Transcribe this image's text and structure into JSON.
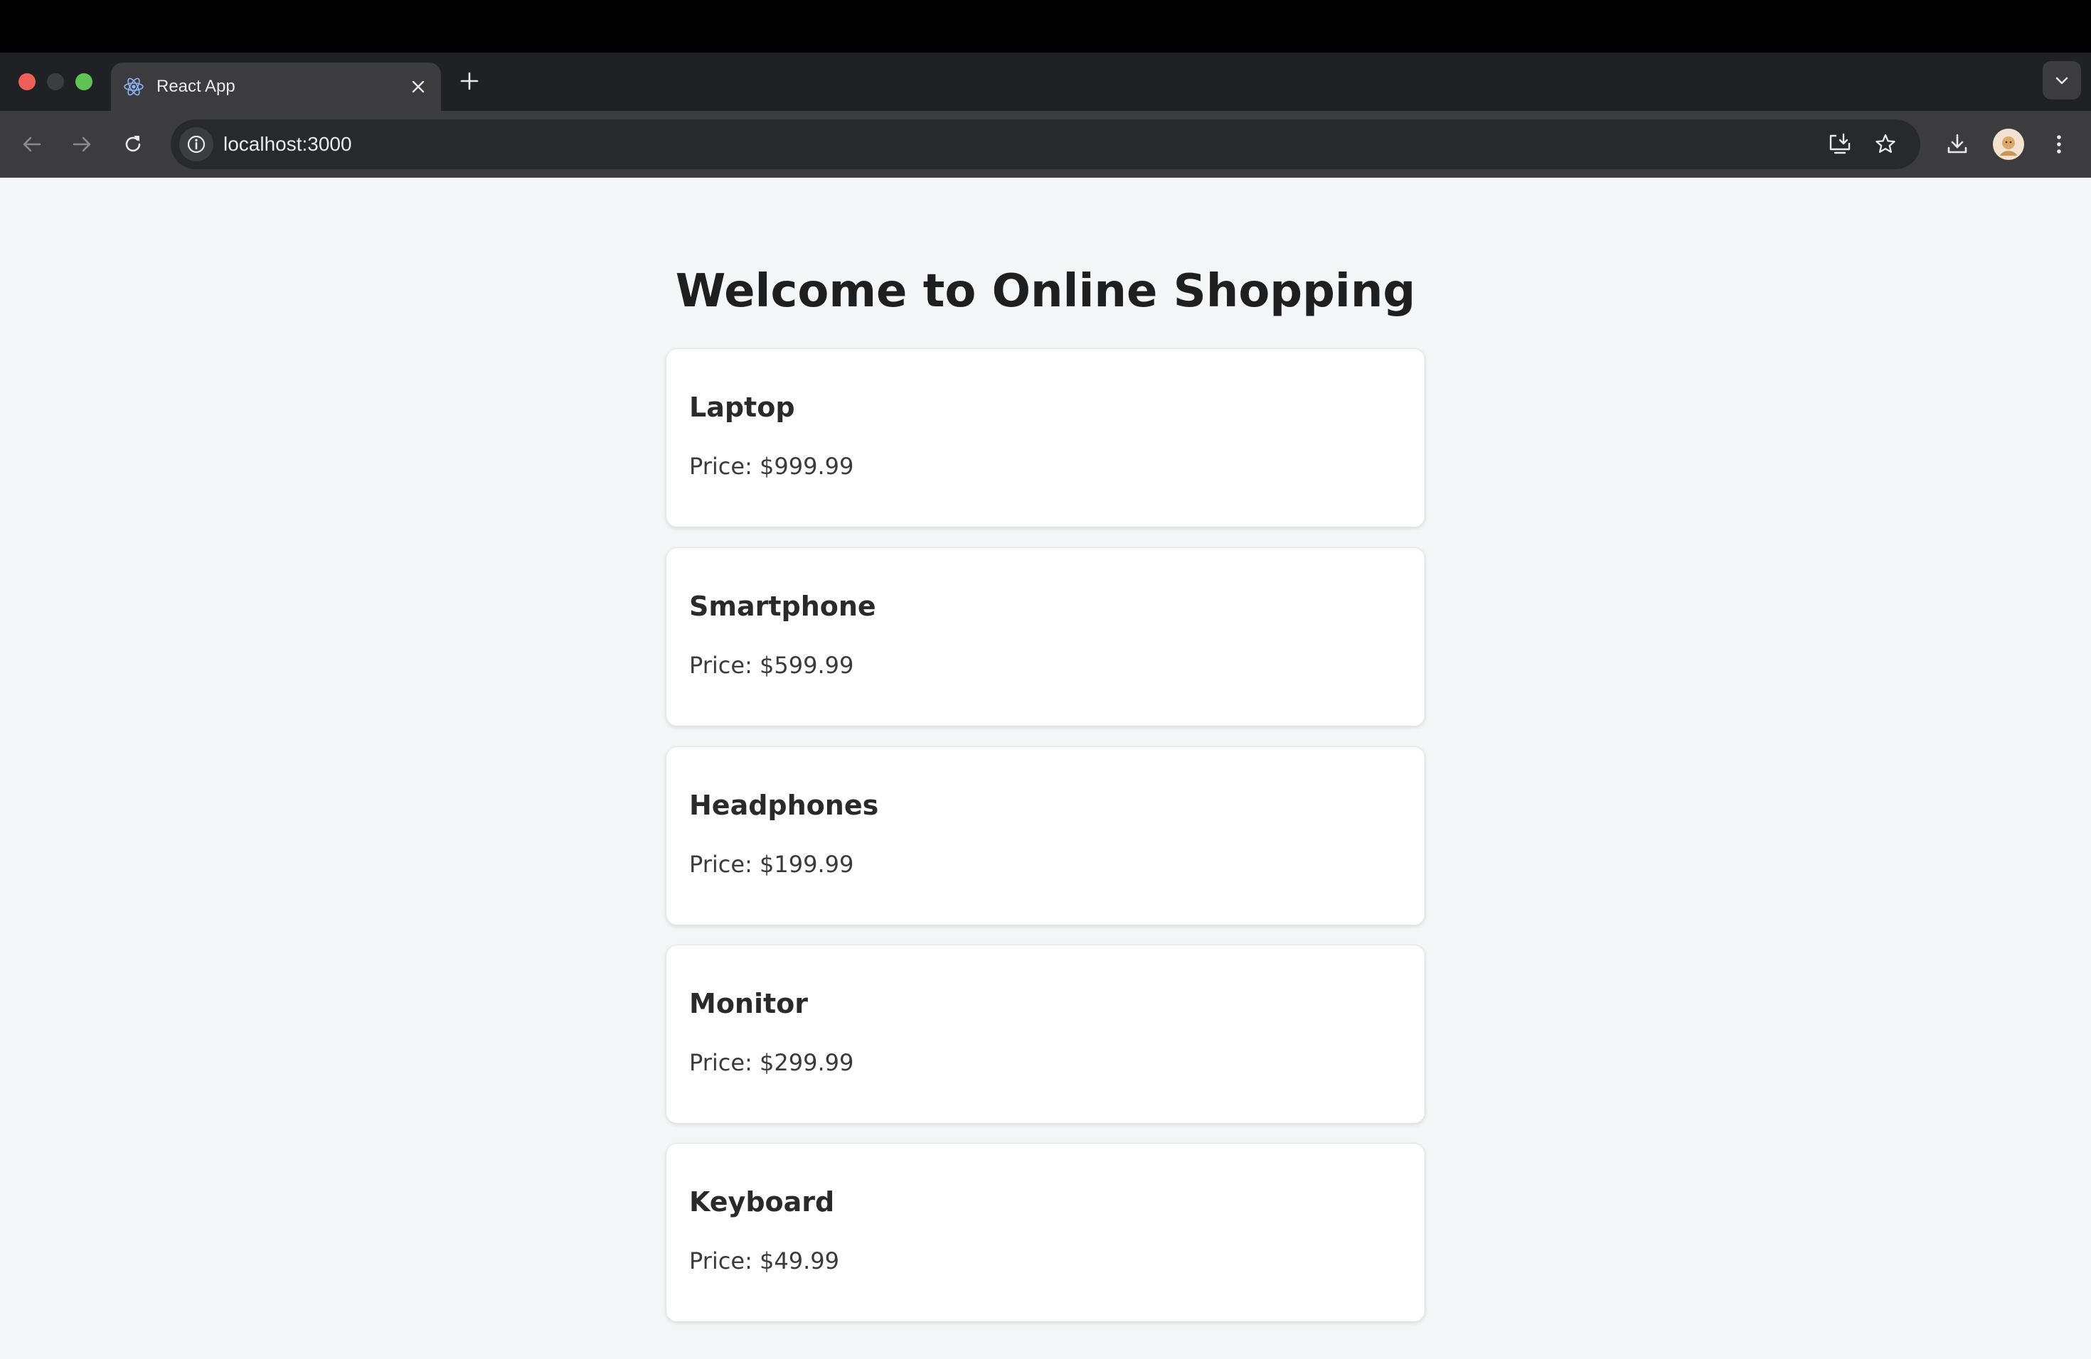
{
  "browser": {
    "tab": {
      "title": "React App",
      "favicon": "react-logo-icon"
    },
    "address_bar": {
      "url": "localhost:3000"
    },
    "icons": {
      "back": "arrow-left-icon",
      "forward": "arrow-right-icon",
      "reload": "reload-icon",
      "site_info": "info-icon",
      "install": "install-app-icon",
      "bookmark": "star-icon",
      "downloads": "download-icon",
      "menu": "kebab-menu-icon",
      "new_tab": "plus-icon",
      "tab_list": "chevron-down-icon"
    }
  },
  "page": {
    "heading": "Welcome to Online Shopping",
    "products": [
      {
        "name": "Laptop",
        "price": "Price: $999.99"
      },
      {
        "name": "Smartphone",
        "price": "Price: $599.99"
      },
      {
        "name": "Headphones",
        "price": "Price: $199.99"
      },
      {
        "name": "Monitor",
        "price": "Price: $299.99"
      },
      {
        "name": "Keyboard",
        "price": "Price: $49.99"
      }
    ]
  },
  "colors": {
    "page_background": "#f5f6f8",
    "heading_text": "#1f1f1f",
    "card_background": "#ffffff",
    "browser_chrome": "#3c3c3f"
  }
}
